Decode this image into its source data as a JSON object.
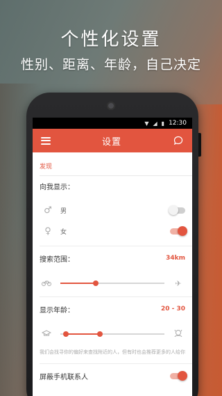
{
  "promo": {
    "headline": "个性化设置",
    "subline": "性别、距离、年龄，自己决定"
  },
  "status_bar": {
    "time": "12:30"
  },
  "app_bar": {
    "title": "设置",
    "menu_icon": "hamburger-menu-icon",
    "action_icon": "chat-bubble-icon"
  },
  "section": {
    "label": "发现"
  },
  "show_me": {
    "title": "向我显示：",
    "options": [
      {
        "label": "男",
        "icon": "male-icon",
        "enabled": false
      },
      {
        "label": "女",
        "icon": "female-icon",
        "enabled": true
      }
    ]
  },
  "distance": {
    "title": "搜索范围：",
    "value": "34km",
    "slider_fraction": 0.34,
    "start_icon": "bicycle-icon",
    "end_icon": "airplane-icon"
  },
  "age": {
    "title": "显示年龄：",
    "value": "20 - 30",
    "range_low_fraction": 0.05,
    "range_high_fraction": 0.38,
    "start_icon": "graduation-cap-icon",
    "end_icon": "elder-icon"
  },
  "note": "我们会找寻你的偏好来查找附近的人，但有时也会推荐更多的人给你",
  "block_contacts": {
    "label": "屏蔽手机联系人",
    "enabled": true
  },
  "colors": {
    "accent": "#e2553f",
    "statusbar": "#000000"
  }
}
